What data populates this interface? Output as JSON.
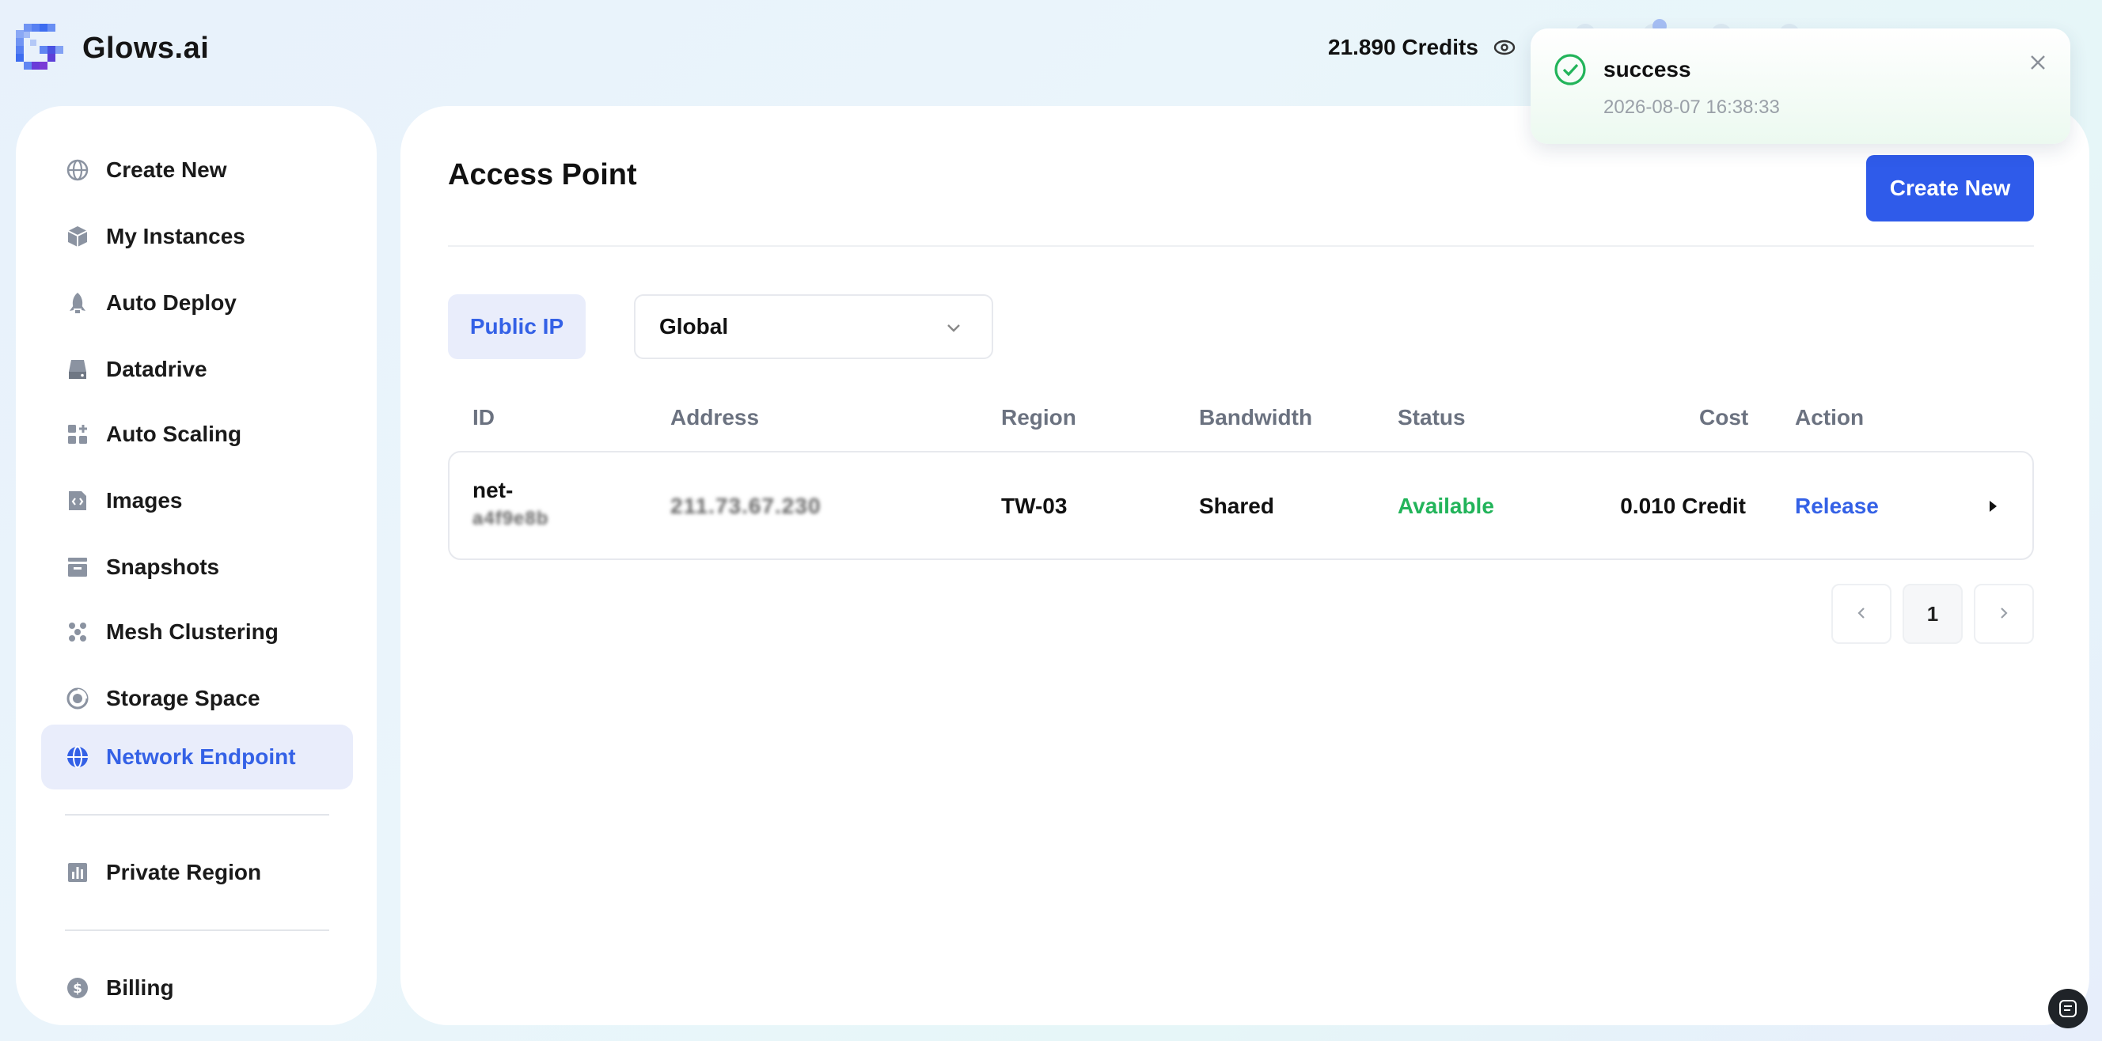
{
  "brand": {
    "name": "Glows.ai"
  },
  "header": {
    "credits_label": "21.890 Credits"
  },
  "sidebar": {
    "items": [
      {
        "label": "Create New",
        "icon": "globe-icon"
      },
      {
        "label": "My Instances",
        "icon": "cube-icon"
      },
      {
        "label": "Auto Deploy",
        "icon": "rocket-icon"
      },
      {
        "label": "Datadrive",
        "icon": "drive-icon"
      },
      {
        "label": "Auto Scaling",
        "icon": "grid-plus-icon"
      },
      {
        "label": "Images",
        "icon": "image-code-icon"
      },
      {
        "label": "Snapshots",
        "icon": "archive-icon"
      },
      {
        "label": "Mesh Clustering",
        "icon": "cluster-icon"
      },
      {
        "label": "Storage Space",
        "icon": "storage-icon"
      },
      {
        "label": "Network Endpoint",
        "icon": "network-globe-icon",
        "active": true
      },
      {
        "label": "Private Region",
        "icon": "bar-chart-icon"
      },
      {
        "label": "Billing",
        "icon": "dollar-coin-icon"
      }
    ]
  },
  "main": {
    "title": "Access Point",
    "create_label": "Create New",
    "tab_label": "Public IP",
    "region_select": {
      "value": "Global"
    },
    "table": {
      "headers": [
        "ID",
        "Address",
        "Region",
        "Bandwidth",
        "Status",
        "Cost",
        "Action"
      ],
      "rows": [
        {
          "id_line1": "net-",
          "id_line2": "a4f9e8b",
          "address": "211.73.67.230",
          "region": "TW-03",
          "bandwidth": "Shared",
          "status": "Available",
          "cost": "0.010 Credit",
          "action": "Release"
        }
      ]
    },
    "pagination": {
      "current": "1"
    }
  },
  "toast": {
    "title": "success",
    "time": "2026-08-07 16:38:33"
  },
  "colors": {
    "accent": "#2f5bea",
    "status_available": "#22b45a",
    "active_bg": "#e9edfb"
  }
}
